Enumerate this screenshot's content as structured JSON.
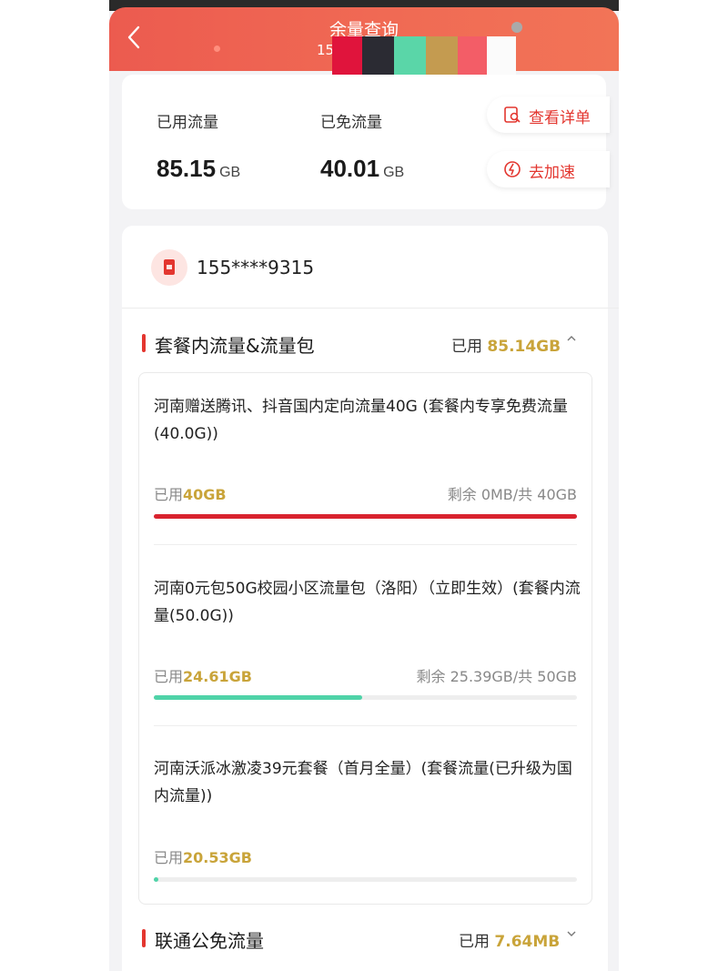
{
  "header": {
    "title": "余量查询",
    "subtitle_visible": "15",
    "back_icon": "back-chevron-icon"
  },
  "summary": {
    "used_label": "已用流量",
    "used_value": "85.15",
    "used_unit": "GB",
    "free_label": "已免流量",
    "free_value": "40.01",
    "free_unit": "GB",
    "detail_button": "查看详单",
    "speed_button": "去加速"
  },
  "account": {
    "phone": "155****9315"
  },
  "plan_section": {
    "title": "套餐内流量&流量包",
    "used_prefix": "已用",
    "used_value": "85.14GB",
    "chevron": "^"
  },
  "packages": [
    {
      "name": "河南赠送腾讯、抖音国内定向流量40G (套餐内专享免费流量(40.0G))",
      "used_prefix": "已用",
      "used_value": "40GB",
      "remaining": "剩余 0MB/共 40GB",
      "progress": 1.0,
      "color": "#d9232f"
    },
    {
      "name": "河南0元包50G校园小区流量包（洛阳）（立即生效）(套餐内流量(50.0G))",
      "used_prefix": "已用",
      "used_value": "24.61GB",
      "remaining": "剩余 25.39GB/共 50GB",
      "progress": 0.4922,
      "color": "#4fd3a8"
    },
    {
      "name": "河南沃派冰激凌39元套餐（首月全量）(套餐流量(已升级为国内流量))",
      "used_prefix": "已用",
      "used_value": "20.53GB",
      "remaining": "",
      "progress": 0.01,
      "color": "#4fd3a8"
    }
  ],
  "free_section": {
    "title": "联通公免流量",
    "used_prefix": "已用",
    "used_value": "7.64MB",
    "chevron": "v"
  },
  "colors": {
    "brand_red": "#e3362f",
    "gold": "#c9a43a",
    "header_start": "#ec5b4f",
    "header_end": "#f27457"
  }
}
